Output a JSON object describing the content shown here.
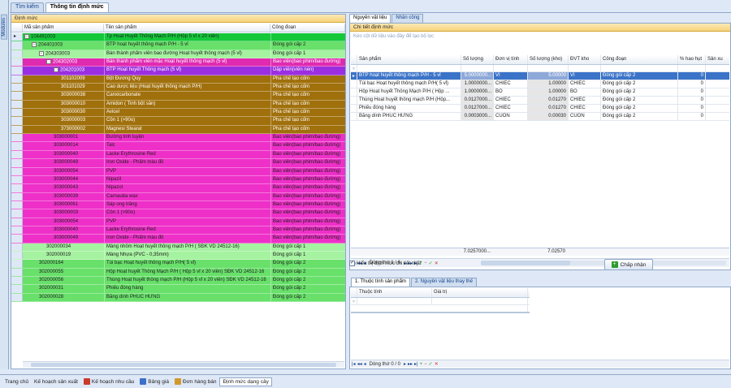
{
  "window": {
    "side_tab": "Modules"
  },
  "main_tabs": [
    {
      "label": "Tìm kiếm"
    },
    {
      "label": "Thông tin định mức"
    }
  ],
  "left": {
    "header": "Định mức",
    "columns": [
      "Mã sản phẩm",
      "Tên sản phẩm",
      "Công đoạn"
    ],
    "rows": [
      {
        "level": 0,
        "toggle": "−",
        "code": "104491003",
        "name": "Tp Hoạt Huyết Thông Mạch P/H (Hộp 5 vỉ x 20 viên)",
        "stage": "",
        "color": "#14c83a"
      },
      {
        "level": 1,
        "toggle": "−",
        "code": "204401003",
        "name": "BTP hoạt huyết thông mạch P/H - 5 vỉ",
        "stage": "Đóng gói cấp 2",
        "color": "#68e06a"
      },
      {
        "level": 2,
        "toggle": "−",
        "code": "204303003",
        "name": "Bán thành phẩm viên bao đường Hoạt huyết thông mạch (5 vỉ)",
        "stage": "Đóng gói cấp 1",
        "color": "#a5f2a0"
      },
      {
        "level": 3,
        "toggle": "−",
        "code": "204302003",
        "name": "Bán thành phẩm viên mặc Hoạt huyết thông mạch (5 vỉ)",
        "stage": "Bao viên(bao phim/bao đường)",
        "color": "#e02ab0"
      },
      {
        "level": 4,
        "toggle": "−",
        "code": "204201003",
        "name": "BTP Hoạt huyết Thông mạch (5 vỉ)",
        "stage": "Dập viên(viên nén)",
        "color": "#9a2ee0"
      },
      {
        "level": 5,
        "toggle": "",
        "code": "301102009",
        "name": "Bột Đương Quy",
        "stage": "Pha chế tạo cốm",
        "color": "#a0700c"
      },
      {
        "level": 5,
        "toggle": "",
        "code": "301101029",
        "name": "Cao dược liệu (Hoạt huyết thông mạch P/H)",
        "stage": "Pha chế tạo cốm",
        "color": "#a0700c"
      },
      {
        "level": 5,
        "toggle": "",
        "code": "303000038",
        "name": "Canxicarbonate",
        "stage": "Pha chế tạo cốm",
        "color": "#a0700c"
      },
      {
        "level": 5,
        "toggle": "",
        "code": "303000010",
        "name": "Amidon ( Tinh bột sắn)",
        "stage": "Pha chế tạo cốm",
        "color": "#a0700c"
      },
      {
        "level": 5,
        "toggle": "",
        "code": "303000030",
        "name": "Avicel",
        "stage": "Pha chế tạo cốm",
        "color": "#a0700c"
      },
      {
        "level": 5,
        "toggle": "",
        "code": "303000003",
        "name": "Cồn 1 (>90o)",
        "stage": "Pha chế tạo cốm",
        "color": "#a0700c"
      },
      {
        "level": 5,
        "toggle": "",
        "code": "373000002",
        "name": "Magnesi Stearat",
        "stage": "Pha chế tạo cốm",
        "color": "#a0700c"
      },
      {
        "level": 4,
        "toggle": "",
        "code": "303000001",
        "name": "Đường tinh luyện",
        "stage": "Bao viên(bao phim/bao đường)",
        "color": "#ee30c8"
      },
      {
        "level": 4,
        "toggle": "",
        "code": "303000014",
        "name": "Talc",
        "stage": "Bao viên(bao phim/bao đường)",
        "color": "#ee30c8"
      },
      {
        "level": 4,
        "toggle": "",
        "code": "303000040",
        "name": "Lacke Erythrosine Red",
        "stage": "Bao viên(bao phim/bao đường)",
        "color": "#ee30c8"
      },
      {
        "level": 4,
        "toggle": "",
        "code": "303000049",
        "name": "Iron Oxide - Phẩm màu đỏ",
        "stage": "Bao viên(bao phim/bao đường)",
        "color": "#ee30c8"
      },
      {
        "level": 4,
        "toggle": "",
        "code": "303000054",
        "name": "PVP",
        "stage": "Bao viên(bao phim/bao đường)",
        "color": "#ee30c8"
      },
      {
        "level": 4,
        "toggle": "",
        "code": "303000044",
        "name": "Nipazil",
        "stage": "Bao viên(bao phim/bao đường)",
        "color": "#ee30c8"
      },
      {
        "level": 4,
        "toggle": "",
        "code": "303000043",
        "name": "Nipazol",
        "stage": "Bao viên(bao phim/bao đường)",
        "color": "#ee30c8"
      },
      {
        "level": 4,
        "toggle": "",
        "code": "303000039",
        "name": "Carnauba wax",
        "stage": "Bao viên(bao phim/bao đường)",
        "color": "#ee30c8"
      },
      {
        "level": 4,
        "toggle": "",
        "code": "303000061",
        "name": "Sáp ong trắng",
        "stage": "Bao viên(bao phim/bao đường)",
        "color": "#ee30c8"
      },
      {
        "level": 4,
        "toggle": "",
        "code": "303000003",
        "name": "Cồn 1 (>90o)",
        "stage": "Bao viên(bao phim/bao đường)",
        "color": "#ee30c8"
      },
      {
        "level": 4,
        "toggle": "",
        "code": "303000054",
        "name": "PVP",
        "stage": "Bao viên(bao phim/bao đường)",
        "color": "#ee30c8"
      },
      {
        "level": 4,
        "toggle": "",
        "code": "303000040",
        "name": "Lacke Erythrosine Red",
        "stage": "Bao viên(bao phim/bao đường)",
        "color": "#ee30c8"
      },
      {
        "level": 4,
        "toggle": "",
        "code": "303000049",
        "name": "Iron Oxide - Phẩm màu đỏ",
        "stage": "Bao viên(bao phim/bao đường)",
        "color": "#ee30c8"
      },
      {
        "level": 3,
        "toggle": "",
        "code": "302000034",
        "name": "Màng nhôm Hoạt huyết thông mạch P/H ( SĐK VD 24512-16)",
        "stage": "Đóng gói cấp 1",
        "color": "#a5f2a0"
      },
      {
        "level": 3,
        "toggle": "",
        "code": "302000019",
        "name": "Màng Nhựa (PVC - 0,35mm)",
        "stage": "Đóng gói cấp 1",
        "color": "#a5f2a0"
      },
      {
        "level": 2,
        "toggle": "",
        "code": "302000164",
        "name": "Túi bạc Hoạt huyết thông mạch P/H( 5 vỉ)",
        "stage": "Đóng gói cấp 2",
        "color": "#68e06a"
      },
      {
        "level": 2,
        "toggle": "",
        "code": "302000055",
        "name": "Hộp Hoạt huyết Thông Mạch P/H ( Hộp 5 vỉ x 20 viên) SĐK VD 24512-16",
        "stage": "Đóng gói cấp 2",
        "color": "#68e06a"
      },
      {
        "level": 2,
        "toggle": "",
        "code": "302000056",
        "name": "Thùng Hoạt huyết thông mạch P/H (Hộp 5 vỉ x 20 viên) SĐK VD 24512-16",
        "stage": "Đóng gói cấp 2",
        "color": "#68e06a"
      },
      {
        "level": 2,
        "toggle": "",
        "code": "302000031",
        "name": "Phiếu đóng hàng",
        "stage": "Đóng gói cấp 2",
        "color": "#68e06a"
      },
      {
        "level": 2,
        "toggle": "",
        "code": "302000028",
        "name": "Băng dính PHÚC HƯNG",
        "stage": "Đóng gói cấp 2",
        "color": "#68e06a"
      }
    ]
  },
  "right": {
    "tabs": [
      {
        "label": "Nguyên vật liệu"
      },
      {
        "label": "Nhân công"
      }
    ],
    "header": "Chi tiết định mức",
    "filter_hint": "Kéo cột dữ liệu vào đây để tạo bộ lọc",
    "columns": [
      "Sản phẩm",
      "Số lượng",
      "Đơn vị tính",
      "Số lượng (kho)",
      "ĐVT kho",
      "Công đoạn",
      "% hao hụt",
      "Sản xu"
    ],
    "rows": [
      {
        "product": "BTP hoạt huyết thông mạch P/H - 5 vỉ",
        "qty": "5.0000000...",
        "unit": "VI",
        "qty_store": "5.00000",
        "unit_store": "VI",
        "stage": "Đóng gói cấp 2",
        "loss": "0",
        "selected": true
      },
      {
        "product": "Túi bạc Hoạt huyết thông mạch P/H( 5 vỉ)",
        "qty": "1.0000000...",
        "unit": "CHIEC",
        "qty_store": "1.00000",
        "unit_store": "CHIEC",
        "stage": "Đóng gói cấp 2",
        "loss": "0",
        "selected": false
      },
      {
        "product": "Hộp Hoạt huyết Thông Mạch P/H ( Hộp ...",
        "qty": "1.0000000...",
        "unit": "BO",
        "qty_store": "1.00000",
        "unit_store": "BO",
        "stage": "Đóng gói cấp 2",
        "loss": "0",
        "selected": false
      },
      {
        "product": "Thùng Hoạt huyết thông mạch P/H (Hộp...",
        "qty": "0.0127000...",
        "unit": "CHIEC",
        "qty_store": "0.01270",
        "unit_store": "CHIEC",
        "stage": "Đóng gói cấp 2",
        "loss": "0",
        "selected": false
      },
      {
        "product": "Phiếu đóng hàng",
        "qty": "0.0127000...",
        "unit": "CHIEC",
        "qty_store": "0.01270",
        "unit_store": "CHIEC",
        "stage": "Đóng gói cấp 2",
        "loss": "0",
        "selected": false
      },
      {
        "product": "Băng dính PHÚC HƯNG",
        "qty": "0.0003000...",
        "unit": "CUON",
        "qty_store": "0.00030",
        "unit_store": "CUON",
        "stage": "Đóng gói cấp 2",
        "loss": "0",
        "selected": false
      }
    ],
    "sum_qty": "7.0257000...",
    "sum_qty_store": "7.02570",
    "nav_label": "Dòng thứ 1 / 6",
    "show_latest_label": "Hiển thị định mức chi tiết nhất",
    "accept_label": "Chấp nhận",
    "bottom_tabs": [
      {
        "label": "1. Thuộc tính sản phẩm"
      },
      {
        "label": "2. Nguyên vật liệu thay thế"
      }
    ],
    "bottom_columns": [
      "Thuộc tính",
      "Giá trị"
    ],
    "bottom_nav_label": "Dòng thứ 0 / 0"
  },
  "statusbar": [
    {
      "label": "Trang chủ",
      "icon": "home-icon",
      "color": ""
    },
    {
      "label": "Kế hoạch sản xuất",
      "icon": "plan-icon",
      "color": ""
    },
    {
      "label": "Kế hoạch nhu cầu",
      "icon": "demand-icon",
      "color": "#c93b2b"
    },
    {
      "label": "Bảng giá",
      "icon": "price-icon",
      "color": "#3b6fc9"
    },
    {
      "label": "Đơn hàng bán",
      "icon": "order-icon",
      "color": "#d09a2a"
    },
    {
      "label": "Định mức dạng cây",
      "icon": "tree-icon",
      "color": "",
      "active": true
    }
  ]
}
